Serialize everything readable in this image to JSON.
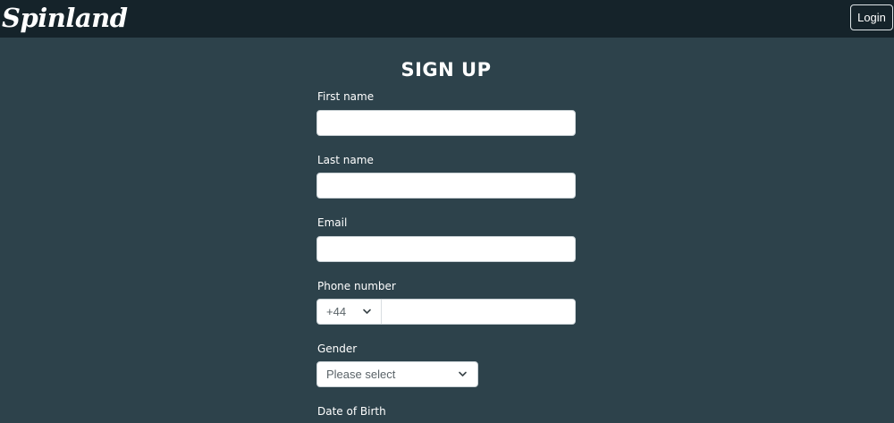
{
  "header": {
    "logo_text": "Spinland",
    "login_label": "Login"
  },
  "form": {
    "title": "SIGN UP",
    "first_name": {
      "label": "First name",
      "value": "",
      "placeholder": ""
    },
    "last_name": {
      "label": "Last name",
      "value": "",
      "placeholder": ""
    },
    "email": {
      "label": "Email",
      "value": "",
      "placeholder": ""
    },
    "phone": {
      "label": "Phone number",
      "country_code": "+44",
      "value": "",
      "placeholder": ""
    },
    "gender": {
      "label": "Gender",
      "selected": "Please select"
    },
    "dob": {
      "label": "Date of Birth"
    }
  },
  "icons": {
    "phone_code_chevron": "chevron-down-icon",
    "gender_chevron": "chevron-down-icon",
    "logo_pin": "map-pin-icon"
  },
  "colors": {
    "header_bg": "#15232a",
    "page_bg": "#2d424b",
    "text": "#ffffff",
    "input_bg": "#ffffff"
  }
}
